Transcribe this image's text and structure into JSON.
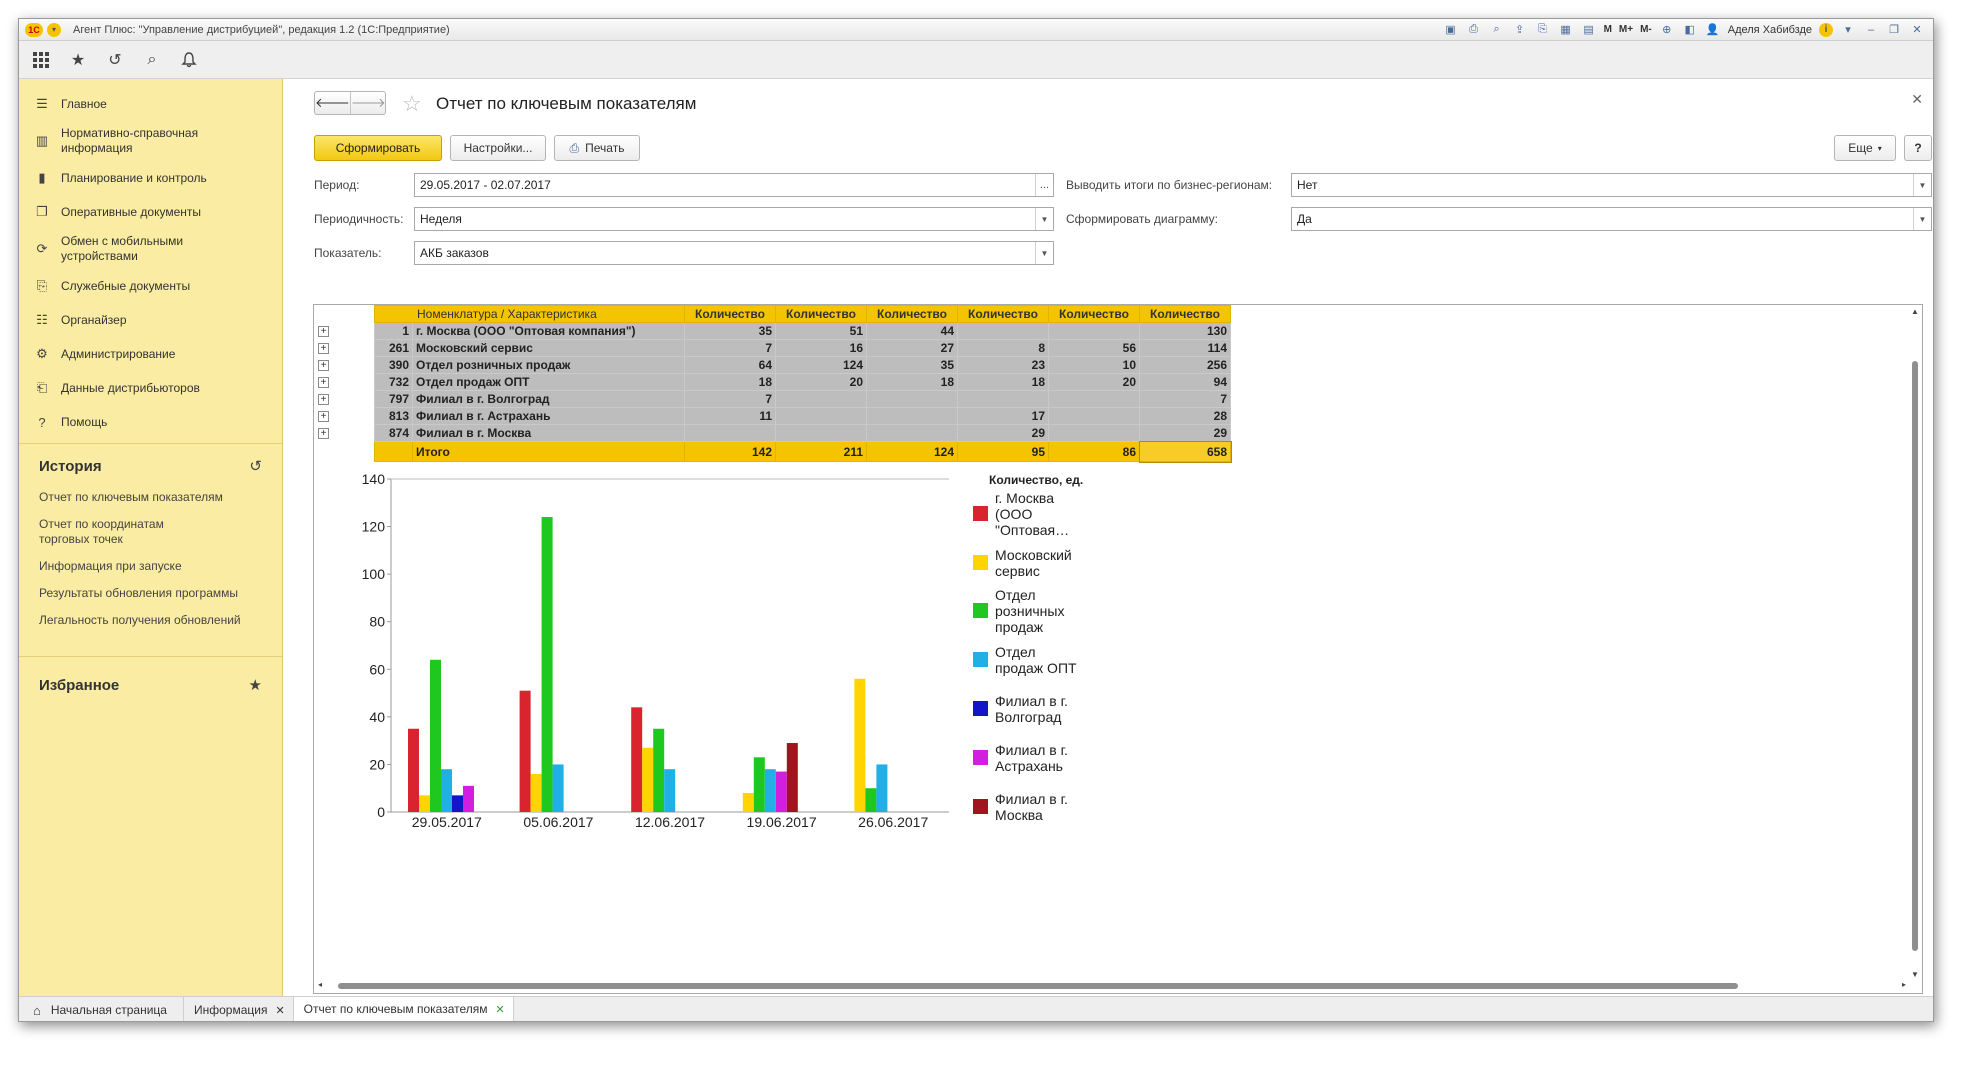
{
  "window": {
    "title": "Агент Плюс: \"Управление дистрибуцией\", редакция 1.2  (1С:Предприятие)",
    "user": "Аделя Хабибзде",
    "title_tools": [
      "M",
      "M+",
      "M-"
    ]
  },
  "sidebar": {
    "items": [
      {
        "icon": "menu-icon",
        "label": "Главное"
      },
      {
        "icon": "catalog-icon",
        "label": "Нормативно-справочная информация"
      },
      {
        "icon": "chart-icon",
        "label": "Планирование и контроль"
      },
      {
        "icon": "documents-icon",
        "label": "Оперативные документы"
      },
      {
        "icon": "sync-icon",
        "label": "Обмен с мобильными устройствами"
      },
      {
        "icon": "service-docs-icon",
        "label": "Служебные документы"
      },
      {
        "icon": "organizer-icon",
        "label": "Органайзер"
      },
      {
        "icon": "gear-icon",
        "label": "Администрирование"
      },
      {
        "icon": "distributor-data-icon",
        "label": "Данные дистрибьюторов"
      },
      {
        "icon": "help-icon",
        "label": "Помощь"
      }
    ],
    "history_title": "История",
    "history": [
      "Отчет по ключевым показателям",
      "Отчет по координатам торговых точек",
      "Информация при запуске",
      "Результаты обновления программы",
      "Легальность получения обновлений"
    ],
    "favorites_title": "Избранное"
  },
  "page": {
    "title": "Отчет по ключевым показателям",
    "btn_generate": "Сформировать",
    "btn_settings": "Настройки...",
    "btn_print": "Печать",
    "btn_more": "Еще",
    "btn_help": "?"
  },
  "filters": {
    "period_label": "Период:",
    "period_value": "29.05.2017 - 02.07.2017",
    "period_btn": "...",
    "periodicity_label": "Периодичность:",
    "periodicity_value": "Неделя",
    "indicator_label": "Показатель:",
    "indicator_value": "АКБ заказов",
    "regions_label": "Выводить итоги по бизнес-регионам:",
    "regions_value": "Нет",
    "diagram_label": "Сформировать диаграмму:",
    "diagram_value": "Да"
  },
  "table": {
    "header_name": "Номенклатура / Характеристика",
    "header_qty": [
      "Количество",
      "Количество",
      "Количество",
      "Количество",
      "Количество",
      "Количество"
    ],
    "rows": [
      {
        "code": "1",
        "name": "г. Москва  (ООО \"Оптовая компания\")",
        "values": [
          "35",
          "51",
          "44",
          "",
          "",
          "130"
        ]
      },
      {
        "code": "261",
        "name": "Московский сервис",
        "values": [
          "7",
          "16",
          "27",
          "8",
          "56",
          "114"
        ]
      },
      {
        "code": "390",
        "name": "Отдел розничных продаж",
        "values": [
          "64",
          "124",
          "35",
          "23",
          "10",
          "256"
        ]
      },
      {
        "code": "732",
        "name": "Отдел продаж ОПТ",
        "values": [
          "18",
          "20",
          "18",
          "18",
          "20",
          "94"
        ]
      },
      {
        "code": "797",
        "name": "Филиал в г. Волгоград",
        "values": [
          "7",
          "",
          "",
          "",
          "",
          "7"
        ]
      },
      {
        "code": "813",
        "name": "Филиал в г. Астрахань",
        "values": [
          "11",
          "",
          "",
          "17",
          "",
          "28"
        ]
      },
      {
        "code": "874",
        "name": "Филиал в г. Москва",
        "values": [
          "",
          "",
          "",
          "29",
          "",
          "29"
        ]
      }
    ],
    "total_label": "Итого",
    "totals": [
      "142",
      "211",
      "124",
      "95",
      "86",
      "658"
    ]
  },
  "chart_data": {
    "type": "bar",
    "categories": [
      "29.05.2017",
      "05.06.2017",
      "12.06.2017",
      "19.06.2017",
      "26.06.2017"
    ],
    "ylim": [
      0,
      140
    ],
    "yticks": [
      0,
      20,
      40,
      60,
      80,
      100,
      120,
      140
    ],
    "legend_title": "Количество, ед.",
    "legend_position": "right",
    "grid": false,
    "series": [
      {
        "name": "г. Москва (ООО \"Оптовая…",
        "color": "#d9232e",
        "values": [
          35,
          51,
          44,
          0,
          0
        ]
      },
      {
        "name": "Московский сервис",
        "color": "#ffd400",
        "values": [
          7,
          16,
          27,
          8,
          56
        ]
      },
      {
        "name": "Отдел розничных продаж",
        "color": "#1ec81e",
        "values": [
          64,
          124,
          35,
          23,
          10
        ]
      },
      {
        "name": "Отдел продаж ОПТ",
        "color": "#21b0e6",
        "values": [
          18,
          20,
          18,
          18,
          20
        ]
      },
      {
        "name": "Филиал в г. Волгоград",
        "color": "#1414c8",
        "values": [
          7,
          0,
          0,
          0,
          0
        ]
      },
      {
        "name": "Филиал в г. Астрахань",
        "color": "#d21ede",
        "values": [
          11,
          0,
          0,
          17,
          0
        ]
      },
      {
        "name": "Филиал в г. Москва",
        "color": "#a0141e",
        "values": [
          0,
          0,
          0,
          29,
          0
        ]
      }
    ]
  },
  "tabs": [
    {
      "label": "Начальная страница",
      "closable": false,
      "active": false
    },
    {
      "label": "Информация",
      "closable": true,
      "active": false
    },
    {
      "label": "Отчет по ключевым показателям",
      "closable": true,
      "active": true
    }
  ]
}
